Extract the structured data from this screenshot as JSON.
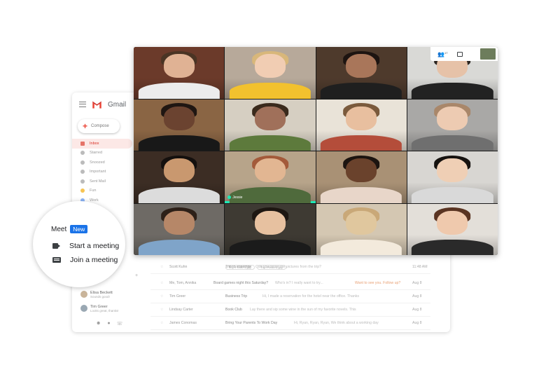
{
  "gmail": {
    "app_name": "Gmail",
    "compose_label": "Compose",
    "nav": [
      {
        "label": "Inbox",
        "icon": "inbox-icon",
        "active": true
      },
      {
        "label": "Starred",
        "icon": "star-icon"
      },
      {
        "label": "Snoozed",
        "icon": "clock-icon"
      },
      {
        "label": "Important",
        "icon": "important-icon"
      },
      {
        "label": "Sent Mail",
        "icon": "send-icon"
      },
      {
        "label": "Fun",
        "icon": "label-icon"
      },
      {
        "label": "Work",
        "icon": "label-icon"
      }
    ],
    "contacts": [
      {
        "name": "Elisa Beckett",
        "status": "Sounds good!"
      },
      {
        "name": "Tim Greer",
        "status": "Looks great, thanks!"
      }
    ],
    "emails": [
      {
        "sender": "Scott Kuhn",
        "subject": "Trip to Yosemite",
        "snippet": "Can you share the pictures from the trip?",
        "tag": "",
        "date": "11:48 AM",
        "attachments": [
          "Trip Photo 1.jpg",
          "Trip Photo 2.jpg"
        ]
      },
      {
        "sender": "Me, Tom, Annika",
        "subject": "Board games night this Saturday?",
        "snippet": "Who's in? I really want to try...",
        "tag": "Want to see you. Follow up?",
        "date": "Aug 8",
        "attachments": []
      },
      {
        "sender": "Tim Greer",
        "subject": "Business Trip",
        "snippet": "Hi, I made a reservation for the hotel near the office. Thanks",
        "tag": "",
        "date": "Aug 8",
        "attachments": []
      },
      {
        "sender": "Lindsay Carter",
        "subject": "Book Club",
        "snippet": "Lay there and sip some wine in the sun of my favorite novels. This",
        "tag": "",
        "date": "Aug 8",
        "attachments": []
      },
      {
        "sender": "James Conomas",
        "subject": "Bring Your Parents To Work Day",
        "snippet": "Hi, Ryan, Ryan, Ryan, We think about a working day",
        "tag": "",
        "date": "Aug 8",
        "attachments": []
      }
    ]
  },
  "meet": {
    "label": "Meet",
    "badge": "New",
    "start_label": "Start a meeting",
    "join_label": "Join a meeting",
    "participant_count": "17",
    "speaker_name": "Jessie",
    "accent": "#1de9b6",
    "badge_color": "#1a73e8"
  },
  "tiles": [
    {
      "bg": "#6b3a2a",
      "skin": "#e0b294",
      "hair": "#4a3424",
      "shirt": "#ececec"
    },
    {
      "bg": "#b7a99a",
      "skin": "#f1cdb3",
      "hair": "#d8b77a",
      "shirt": "#f2c12e"
    },
    {
      "bg": "#4e3a2c",
      "skin": "#a9765a",
      "hair": "#1d1411",
      "shirt": "#1f1f1f"
    },
    {
      "bg": "#d9d9d6",
      "skin": "#e6c2a8",
      "hair": "#2b2520",
      "shirt": "#222222"
    },
    {
      "bg": "#8a6544",
      "skin": "#6b4330",
      "hair": "#1f1612",
      "shirt": "#181818"
    },
    {
      "bg": "#d6cfc2",
      "skin": "#a0705a",
      "hair": "#3a2a1c",
      "shirt": "#5d7a3c"
    },
    {
      "bg": "#e9e3d8",
      "skin": "#e8bf9f",
      "hair": "#7a5a3c",
      "shirt": "#b44d3a"
    },
    {
      "bg": "#a9a8a6",
      "skin": "#edcbb2",
      "hair": "#a9876a",
      "shirt": "#6f6f6f"
    },
    {
      "bg": "#3c2d24",
      "skin": "#c9986f",
      "hair": "#14100e",
      "shirt": "#dcdcdc"
    },
    {
      "bg": "#b7a48a",
      "skin": "#e2b692",
      "hair": "#a35a3a",
      "shirt": "#4f6a3c"
    },
    {
      "bg": "#a99175",
      "skin": "#6a422c",
      "hair": "#1c1410",
      "shirt": "#e8d6c9"
    },
    {
      "bg": "#d8d6d2",
      "skin": "#efcfb5",
      "hair": "#16120f",
      "shirt": "#d9d9d9"
    },
    {
      "bg": "#6e6a65",
      "skin": "#b68768",
      "hair": "#2d2018",
      "shirt": "#7fa4c9"
    },
    {
      "bg": "#3e3a33",
      "skin": "#e7c1a0",
      "hair": "#1e1712",
      "shirt": "#1b1b1b"
    },
    {
      "bg": "#d4c7b2",
      "skin": "#e0c79e",
      "hair": "#c9a878",
      "shirt": "#f3eadc"
    },
    {
      "bg": "#e3dfd9",
      "skin": "#efc9ad",
      "hair": "#5a3422",
      "shirt": "#2a2a2a"
    }
  ]
}
